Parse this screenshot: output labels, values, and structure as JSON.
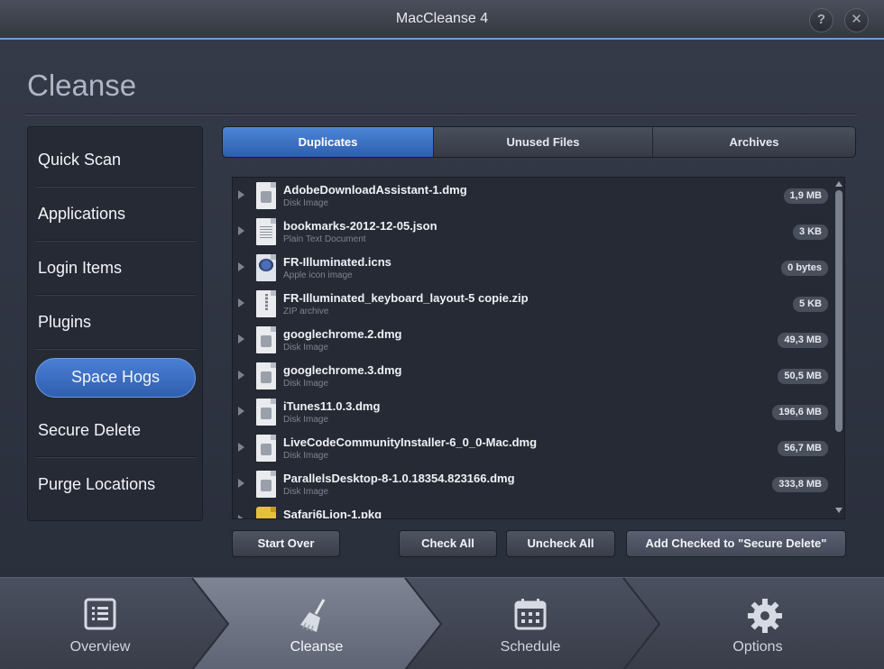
{
  "window": {
    "title": "MacCleanse 4",
    "help_label": "?",
    "close_label": "✕"
  },
  "page": {
    "heading": "Cleanse"
  },
  "sidebar": {
    "items": [
      {
        "label": "Quick Scan"
      },
      {
        "label": "Applications"
      },
      {
        "label": "Login Items"
      },
      {
        "label": "Plugins"
      },
      {
        "label": "Space Hogs",
        "active": true
      },
      {
        "label": "Secure Delete"
      },
      {
        "label": "Purge Locations"
      }
    ]
  },
  "tabs": [
    {
      "label": "Duplicates",
      "selected": true
    },
    {
      "label": "Unused Files"
    },
    {
      "label": "Archives"
    }
  ],
  "files": [
    {
      "name": "AdobeDownloadAssistant-1.dmg",
      "kind": "Disk Image",
      "size": "1,9 MB",
      "icon": "disk-image-icon"
    },
    {
      "name": "bookmarks-2012-12-05.json",
      "kind": "Plain Text Document",
      "size": "3 KB",
      "icon": "text-document-icon"
    },
    {
      "name": "FR-Illuminated.icns",
      "kind": "Apple icon image",
      "size": "0 bytes",
      "icon": "icns-file-icon"
    },
    {
      "name": "FR-Illuminated_keyboard_layout-5 copie.zip",
      "kind": "ZIP archive",
      "size": "5 KB",
      "icon": "zip-archive-icon"
    },
    {
      "name": "googlechrome.2.dmg",
      "kind": "Disk Image",
      "size": "49,3 MB",
      "icon": "disk-image-icon"
    },
    {
      "name": "googlechrome.3.dmg",
      "kind": "Disk Image",
      "size": "50,5 MB",
      "icon": "disk-image-icon"
    },
    {
      "name": "iTunes11.0.3.dmg",
      "kind": "Disk Image",
      "size": "196,6 MB",
      "icon": "disk-image-icon"
    },
    {
      "name": "LiveCodeCommunityInstaller-6_0_0-Mac.dmg",
      "kind": "Disk Image",
      "size": "56,7 MB",
      "icon": "disk-image-icon"
    },
    {
      "name": "ParallelsDesktop-8-1.0.18354.823166.dmg",
      "kind": "Disk Image",
      "size": "333,8 MB",
      "icon": "disk-image-icon"
    },
    {
      "name": "Safari6Lion-1.pkg",
      "kind": "",
      "size": "",
      "icon": "package-icon"
    }
  ],
  "actions": {
    "start_over": "Start Over",
    "check_all": "Check All",
    "uncheck_all": "Uncheck All",
    "add_checked": "Add Checked to \"Secure Delete\""
  },
  "nav": [
    {
      "label": "Overview",
      "icon": "list-icon"
    },
    {
      "label": "Cleanse",
      "icon": "broom-icon",
      "active": true
    },
    {
      "label": "Schedule",
      "icon": "calendar-icon"
    },
    {
      "label": "Options",
      "icon": "gear-icon"
    }
  ],
  "colors": {
    "accent": "#3f72c4",
    "background": "#2c3140"
  }
}
